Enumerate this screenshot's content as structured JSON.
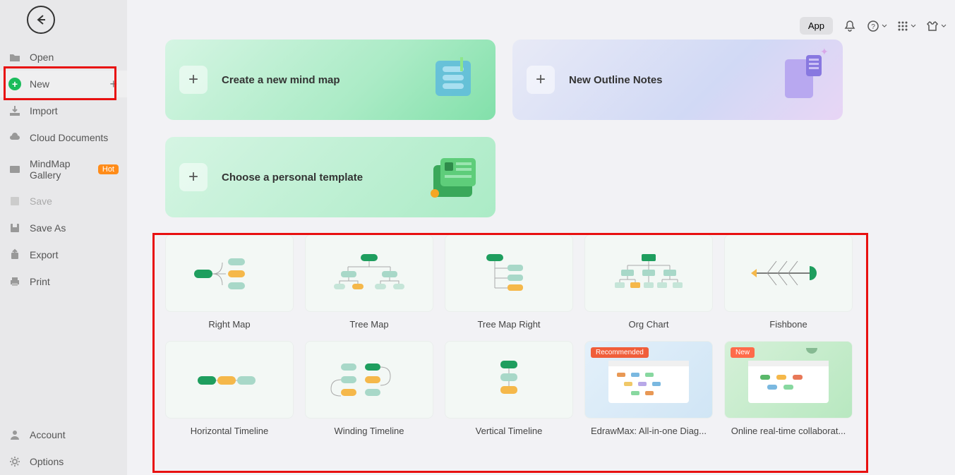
{
  "topbar": {
    "app_label": "App"
  },
  "sidebar": {
    "open": "Open",
    "new": "New",
    "import": "Import",
    "cloud": "Cloud Documents",
    "gallery": "MindMap Gallery",
    "gallery_badge": "Hot",
    "save": "Save",
    "save_as": "Save As",
    "export": "Export",
    "print": "Print",
    "account": "Account",
    "options": "Options"
  },
  "cards": {
    "mindmap": "Create a new mind map",
    "outline": "New Outline Notes",
    "template": "Choose a personal template"
  },
  "templates": [
    {
      "label": "Right Map",
      "type": "rightmap"
    },
    {
      "label": "Tree Map",
      "type": "treemap"
    },
    {
      "label": "Tree Map Right",
      "type": "treemapright"
    },
    {
      "label": "Org Chart",
      "type": "orgchart"
    },
    {
      "label": "Fishbone",
      "type": "fishbone"
    },
    {
      "label": "Horizontal Timeline",
      "type": "htimeline"
    },
    {
      "label": "Winding Timeline",
      "type": "wtimeline"
    },
    {
      "label": "Vertical Timeline",
      "type": "vtimeline"
    },
    {
      "label": "EdrawMax: All-in-one Diag...",
      "type": "edrawmax",
      "badge": "Recommended"
    },
    {
      "label": "Online real-time collaborat...",
      "type": "collab",
      "badge": "New"
    }
  ]
}
